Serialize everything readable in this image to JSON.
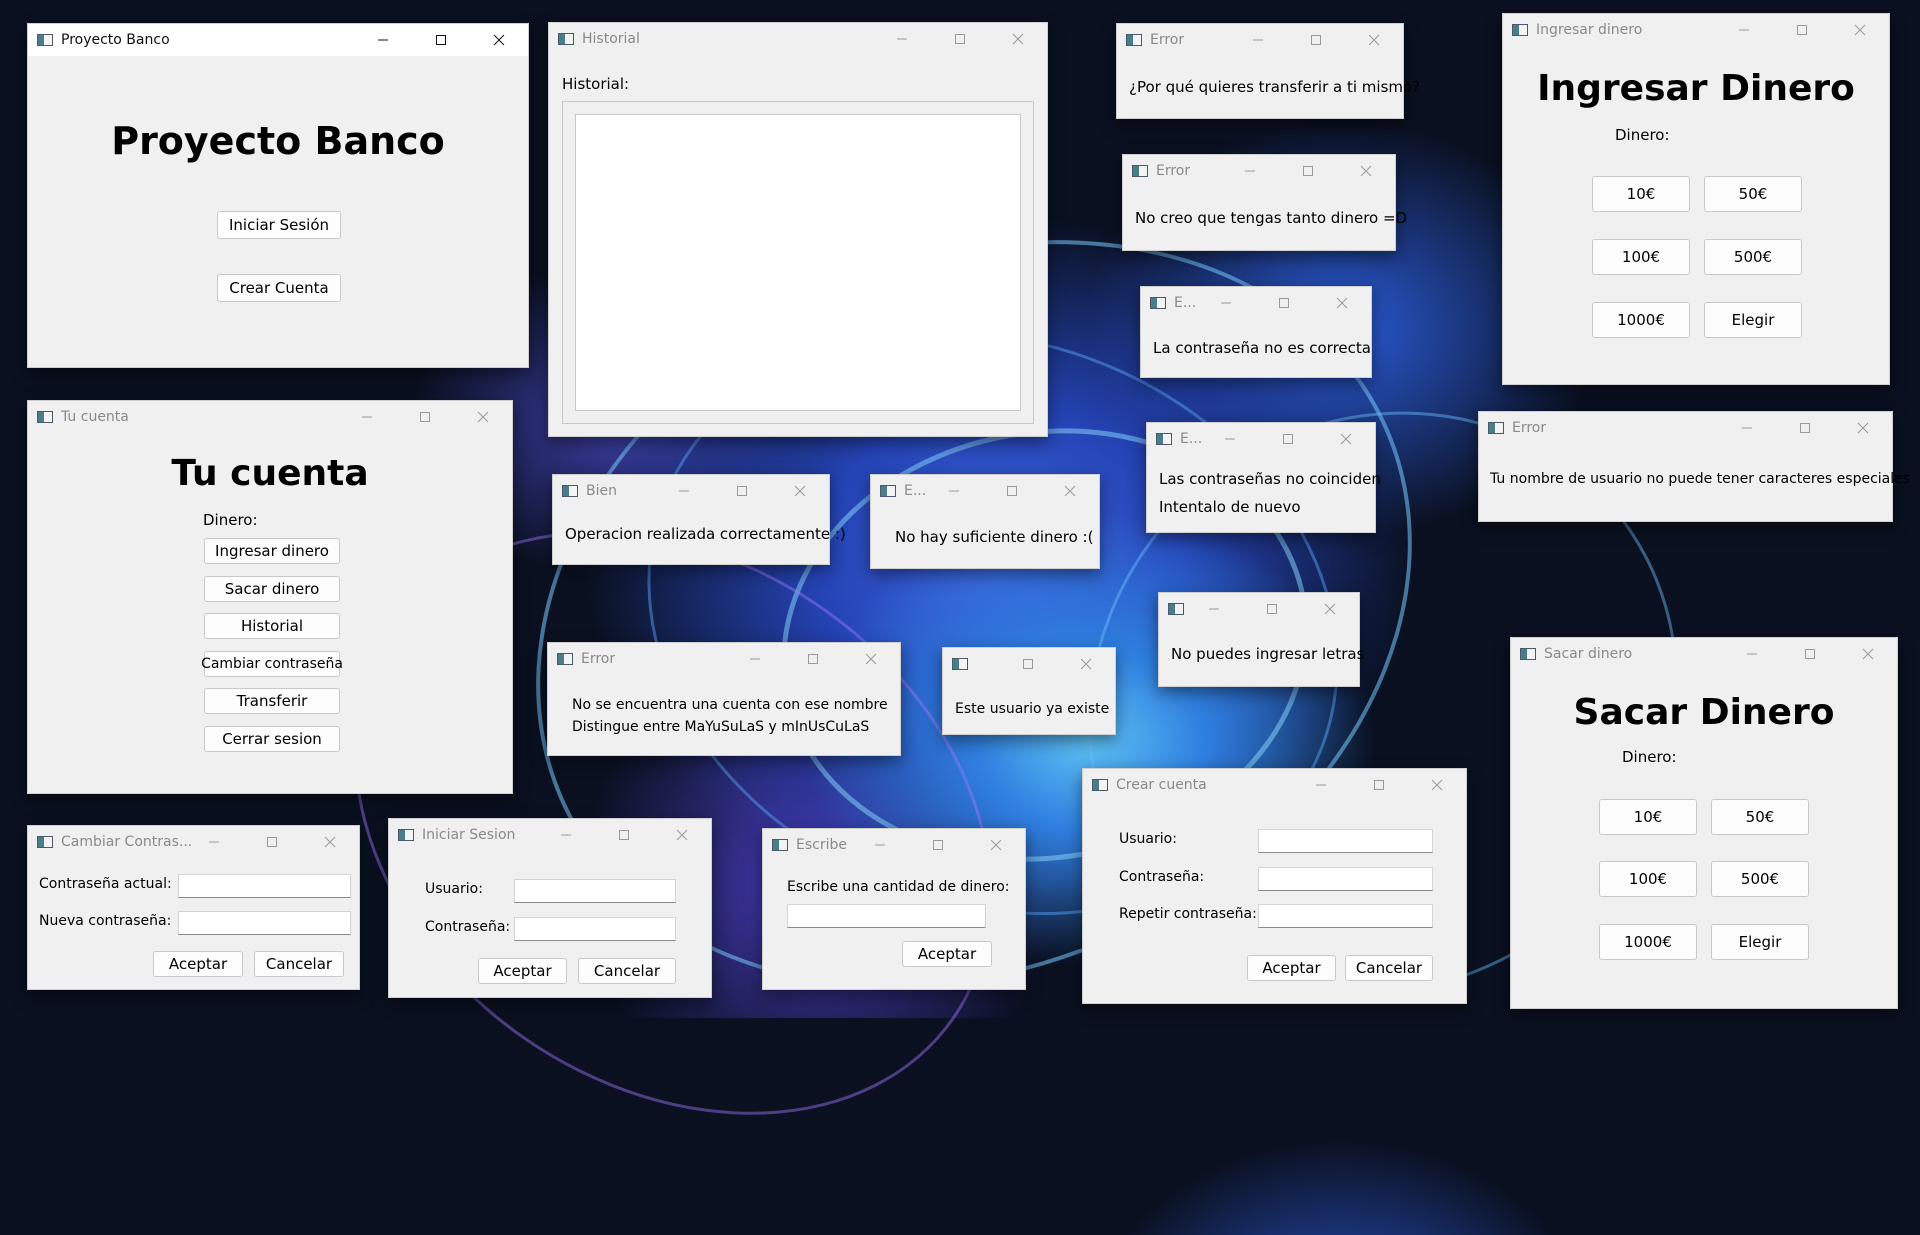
{
  "windows": {
    "proyecto_banco": {
      "title": "Proyecto Banco",
      "heading": "Proyecto Banco",
      "login_button": "Iniciar Sesión",
      "create_button": "Crear Cuenta"
    },
    "historial": {
      "title": "Historial",
      "label": "Historial:"
    },
    "error_self_transfer": {
      "title": "Error",
      "message": "¿Por qué quieres transferir a ti mismo?"
    },
    "error_too_much": {
      "title": "Error",
      "message": "No creo que tengas tanto dinero  =D"
    },
    "error_wrong_password": {
      "title": "E...",
      "message": "La contraseña no es correcta"
    },
    "error_password_mismatch": {
      "title": "E...",
      "line1": "Las contraseñas no coinciden",
      "line2": "Intentalo de nuevo"
    },
    "error_letters": {
      "title": "",
      "message": "No puedes ingresar letras"
    },
    "ingresar": {
      "title": "Ingresar dinero",
      "heading": "Ingresar Dinero",
      "money_label": "Dinero:",
      "amounts": [
        "10€",
        "50€",
        "100€",
        "500€",
        "1000€",
        "Elegir"
      ]
    },
    "error_username": {
      "title": "Error",
      "message": "Tu nombre de usuario no puede tener caracteres especiales"
    },
    "tu_cuenta": {
      "title": "Tu cuenta",
      "heading": "Tu cuenta",
      "money_label": "Dinero:",
      "buttons": [
        "Ingresar dinero",
        "Sacar dinero",
        "Historial",
        "Cambiar contraseña",
        "Transferir",
        "Cerrar sesion"
      ]
    },
    "bien": {
      "title": "Bien",
      "message": "Operacion realizada correctamente  :)"
    },
    "error_insufficient": {
      "title": "E...",
      "message": "No hay suficiente dinero  :("
    },
    "error_not_found": {
      "title": "Error",
      "line1": "No se encuentra una cuenta con ese nombre",
      "line2": "Distingue entre MaYuSuLaS y mInUsCuLaS"
    },
    "error_user_exists": {
      "title": "",
      "message": "Este usuario ya existe"
    },
    "sacar": {
      "title": "Sacar dinero",
      "heading": "Sacar Dinero",
      "money_label": "Dinero:",
      "amounts": [
        "10€",
        "50€",
        "100€",
        "500€",
        "1000€",
        "Elegir"
      ]
    },
    "cambiar": {
      "title": "Cambiar Contras...",
      "current_label": "Contraseña actual:",
      "new_label": "Nueva contraseña:",
      "accept": "Aceptar",
      "cancel": "Cancelar",
      "current_value": "",
      "new_value": ""
    },
    "iniciar": {
      "title": "Iniciar Sesion",
      "user_label": "Usuario:",
      "pass_label": "Contraseña:",
      "accept": "Aceptar",
      "cancel": "Cancelar",
      "user_value": "",
      "pass_value": ""
    },
    "escribe": {
      "title": "Escribe",
      "prompt": "Escribe una cantidad de dinero:",
      "accept": "Aceptar",
      "amount_value": ""
    },
    "crear": {
      "title": "Crear cuenta",
      "user_label": "Usuario:",
      "pass_label": "Contraseña:",
      "repeat_label": "Repetir contraseña:",
      "accept": "Aceptar",
      "cancel": "Cancelar",
      "user_value": "",
      "pass_value": "",
      "repeat_value": ""
    }
  },
  "icons": {
    "window": "app-window-icon",
    "minimize": "minimize-icon",
    "maximize": "maximize-icon",
    "close": "close-icon"
  },
  "colors": {
    "window_bg": "#f0f0f0",
    "focused_titlebar": "#ffffff",
    "desktop_bg": "#0a1020"
  }
}
